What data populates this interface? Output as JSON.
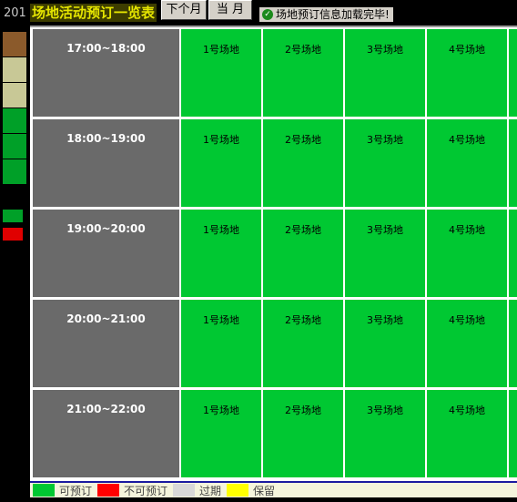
{
  "header": {
    "year_fragment": "201",
    "title": "场地活动预订一览表",
    "next_month_label": "下个月",
    "current_month_label": "当 月",
    "status_message": "场地预订信息加载完毕!"
  },
  "left_strip": {
    "colors": [
      "#8b5a2b",
      "#c8c896",
      "#c8c896",
      "#00a028",
      "#00a028",
      "#00a028"
    ],
    "buttons": [
      "#00a028",
      "#e00000"
    ]
  },
  "rows": [
    {
      "time": "17:00~18:00",
      "venues": [
        "1号场地",
        "2号场地",
        "3号场地",
        "4号场地"
      ]
    },
    {
      "time": "18:00~19:00",
      "venues": [
        "1号场地",
        "2号场地",
        "3号场地",
        "4号场地"
      ]
    },
    {
      "time": "19:00~20:00",
      "venues": [
        "1号场地",
        "2号场地",
        "3号场地",
        "4号场地"
      ]
    },
    {
      "time": "20:00~21:00",
      "venues": [
        "1号场地",
        "2号场地",
        "3号场地",
        "4号场地"
      ]
    },
    {
      "time": "21:00~22:00",
      "venues": [
        "1号场地",
        "2号场地",
        "3号场地",
        "4号场地"
      ]
    }
  ],
  "legend": [
    {
      "color": "#00c832",
      "label": "可预订"
    },
    {
      "color": "#ff0000",
      "label": "不可预订"
    },
    {
      "color": "#d8d8d8",
      "label": "过期"
    },
    {
      "color": "#ffff00",
      "label": "保留"
    }
  ],
  "colors": {
    "available": "#00c832",
    "time_cell": "#6a6a6a",
    "title_text": "#e6e600",
    "title_bg": "#3d3d00"
  }
}
